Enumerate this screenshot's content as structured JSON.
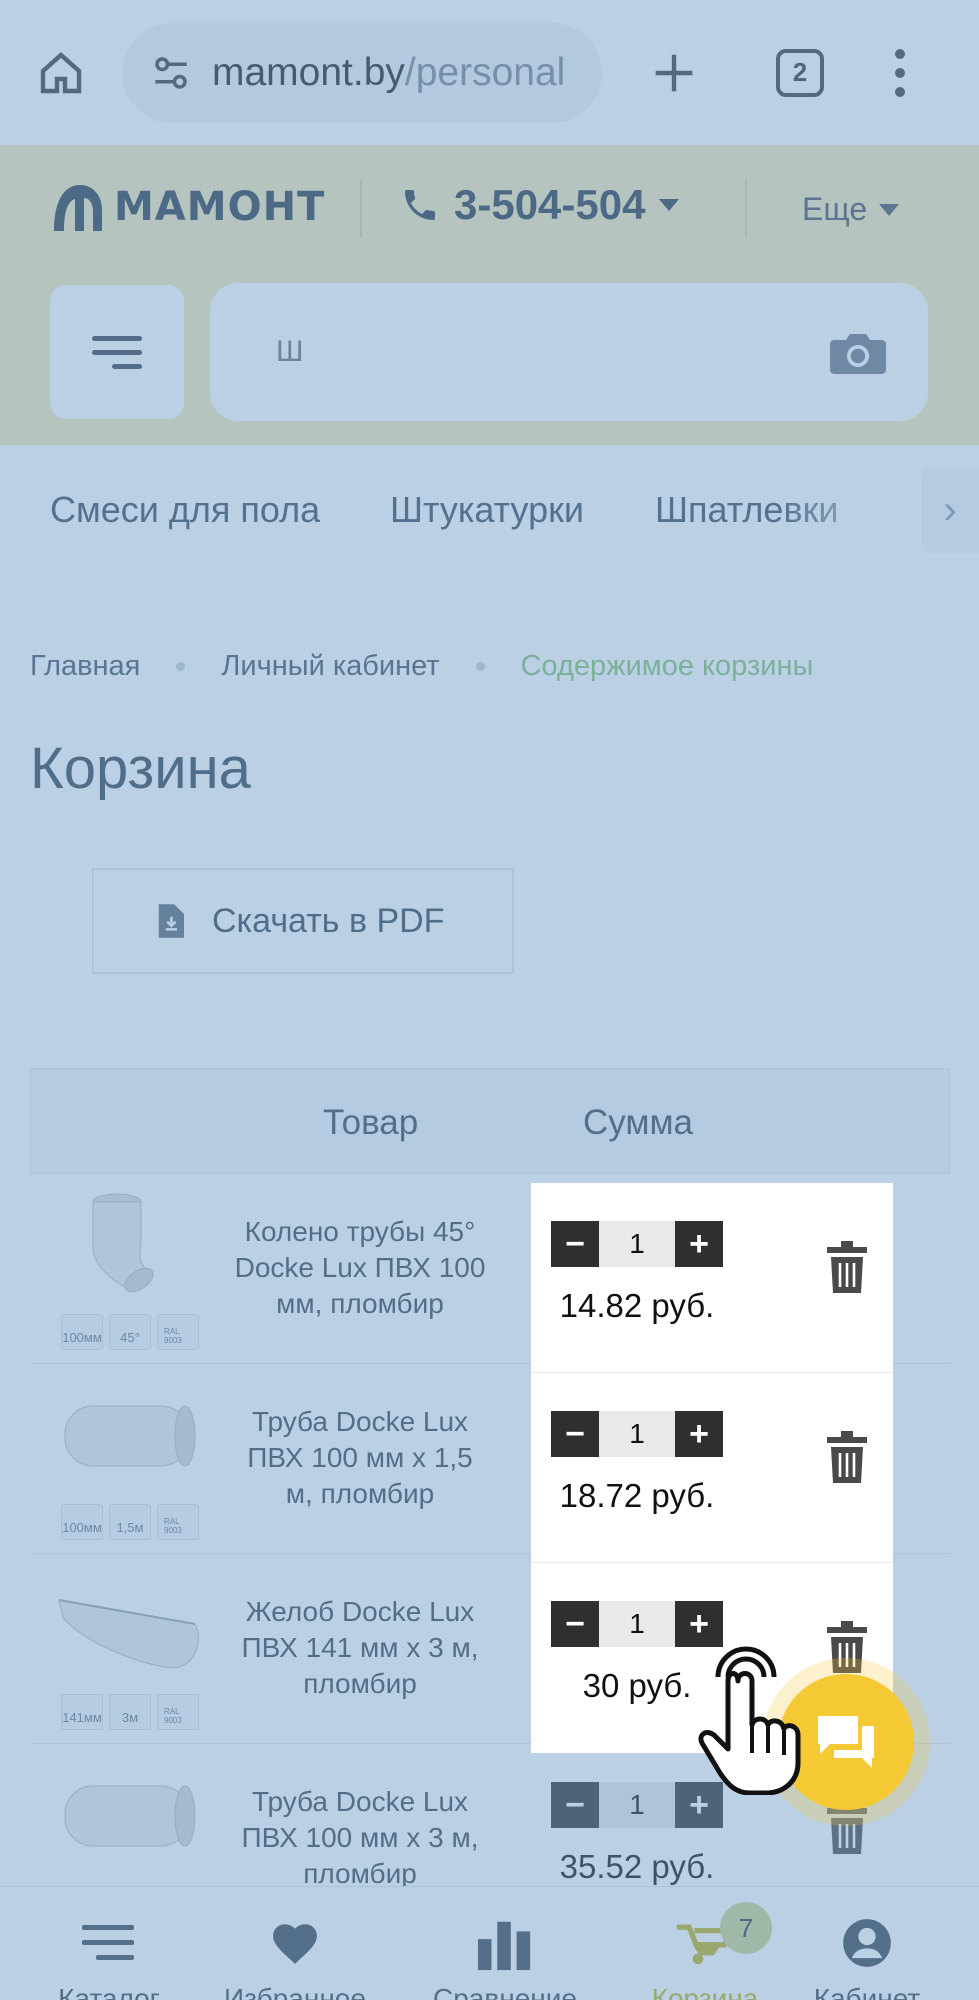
{
  "browser": {
    "url_domain": "mamont.by",
    "url_path": "/personal",
    "tab_count": "2"
  },
  "header": {
    "logo_text": "МАМОНТ",
    "phone": "3-504-504",
    "more_label": "Еще",
    "search_value": "Ш"
  },
  "categories": [
    "Смеси для пола",
    "Штукатурки",
    "Шпатлевки"
  ],
  "breadcrumb": [
    "Главная",
    "Личный кабинет",
    "Содержимое корзины"
  ],
  "page_title": "Корзина",
  "pdf_button": "Скачать в PDF",
  "cart": {
    "headers": {
      "product": "Товар",
      "sum": "Сумма"
    },
    "items": [
      {
        "name": "Колено трубы 45° Docke Lux ПВХ 100 мм, пломбир",
        "qty": "1",
        "price": "14.82 руб.",
        "badges": [
          "100мм",
          "45°",
          "RAL 9003"
        ]
      },
      {
        "name": "Труба Docke Lux ПВХ 100 мм x 1,5 м, пломбир",
        "qty": "1",
        "price": "18.72 руб.",
        "badges": [
          "100мм",
          "1,5м",
          "RAL 9003"
        ]
      },
      {
        "name": "Желоб Docke Lux ПВХ 141 мм x 3 м, пломбир",
        "qty": "1",
        "price": "30 руб.",
        "badges": [
          "141мм",
          "3м",
          "RAL 9003"
        ]
      },
      {
        "name": "Труба Docke Lux ПВХ 100 мм x 3 м, пломбир",
        "qty": "1",
        "price": "35.52 руб.",
        "badges": [
          "",
          "",
          ""
        ]
      }
    ]
  },
  "bottom_nav": [
    {
      "label": "Каталог",
      "icon": "menu-icon"
    },
    {
      "label": "Избранное",
      "icon": "heart-icon"
    },
    {
      "label": "Сравнение",
      "icon": "compare-icon"
    },
    {
      "label": "Корзина",
      "icon": "wheelbarrow-icon"
    },
    {
      "label": "Кабинет",
      "icon": "user-icon"
    }
  ],
  "cart_badge": "7",
  "colors": {
    "overlay": "#709dc8",
    "accent_green": "#84c46e",
    "chat_yellow": "#f5c934",
    "header_bg": "#f6e8b6",
    "stepper_dark": "#2f2f2f"
  }
}
